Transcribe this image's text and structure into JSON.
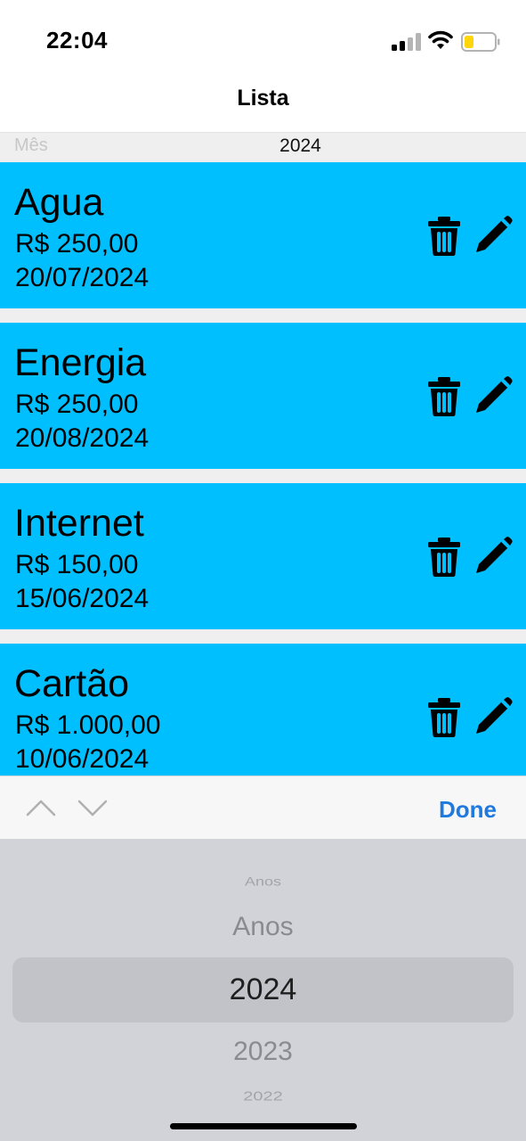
{
  "status_bar": {
    "time": "22:04",
    "icons": [
      "cellular-signal-icon",
      "wifi-icon",
      "battery-low-icon"
    ],
    "battery_color": "#ffd60a"
  },
  "nav": {
    "title": "Lista"
  },
  "filter": {
    "month_placeholder": "Mês",
    "year": "2024"
  },
  "colors": {
    "card_background": "#00bfff",
    "accent": "#1f7ae0"
  },
  "items": [
    {
      "name": "Agua",
      "amount": "R$ 250,00",
      "due_date": "20/07/2024"
    },
    {
      "name": "Energia",
      "amount": "R$ 250,00",
      "due_date": "20/08/2024"
    },
    {
      "name": "Internet",
      "amount": "R$ 150,00",
      "due_date": "15/06/2024"
    },
    {
      "name": "Cartão",
      "amount": "R$ 1.000,00",
      "due_date": "10/06/2024"
    }
  ],
  "item_actions": [
    "trash-icon",
    "pencil-icon"
  ],
  "toolbar": {
    "done_label": "Done",
    "icons": [
      "chevron-up-icon",
      "chevron-down-icon"
    ]
  },
  "picker": {
    "options": [
      "Anos",
      "Anos",
      "2024",
      "2023",
      "2022"
    ],
    "selected": "2024"
  }
}
